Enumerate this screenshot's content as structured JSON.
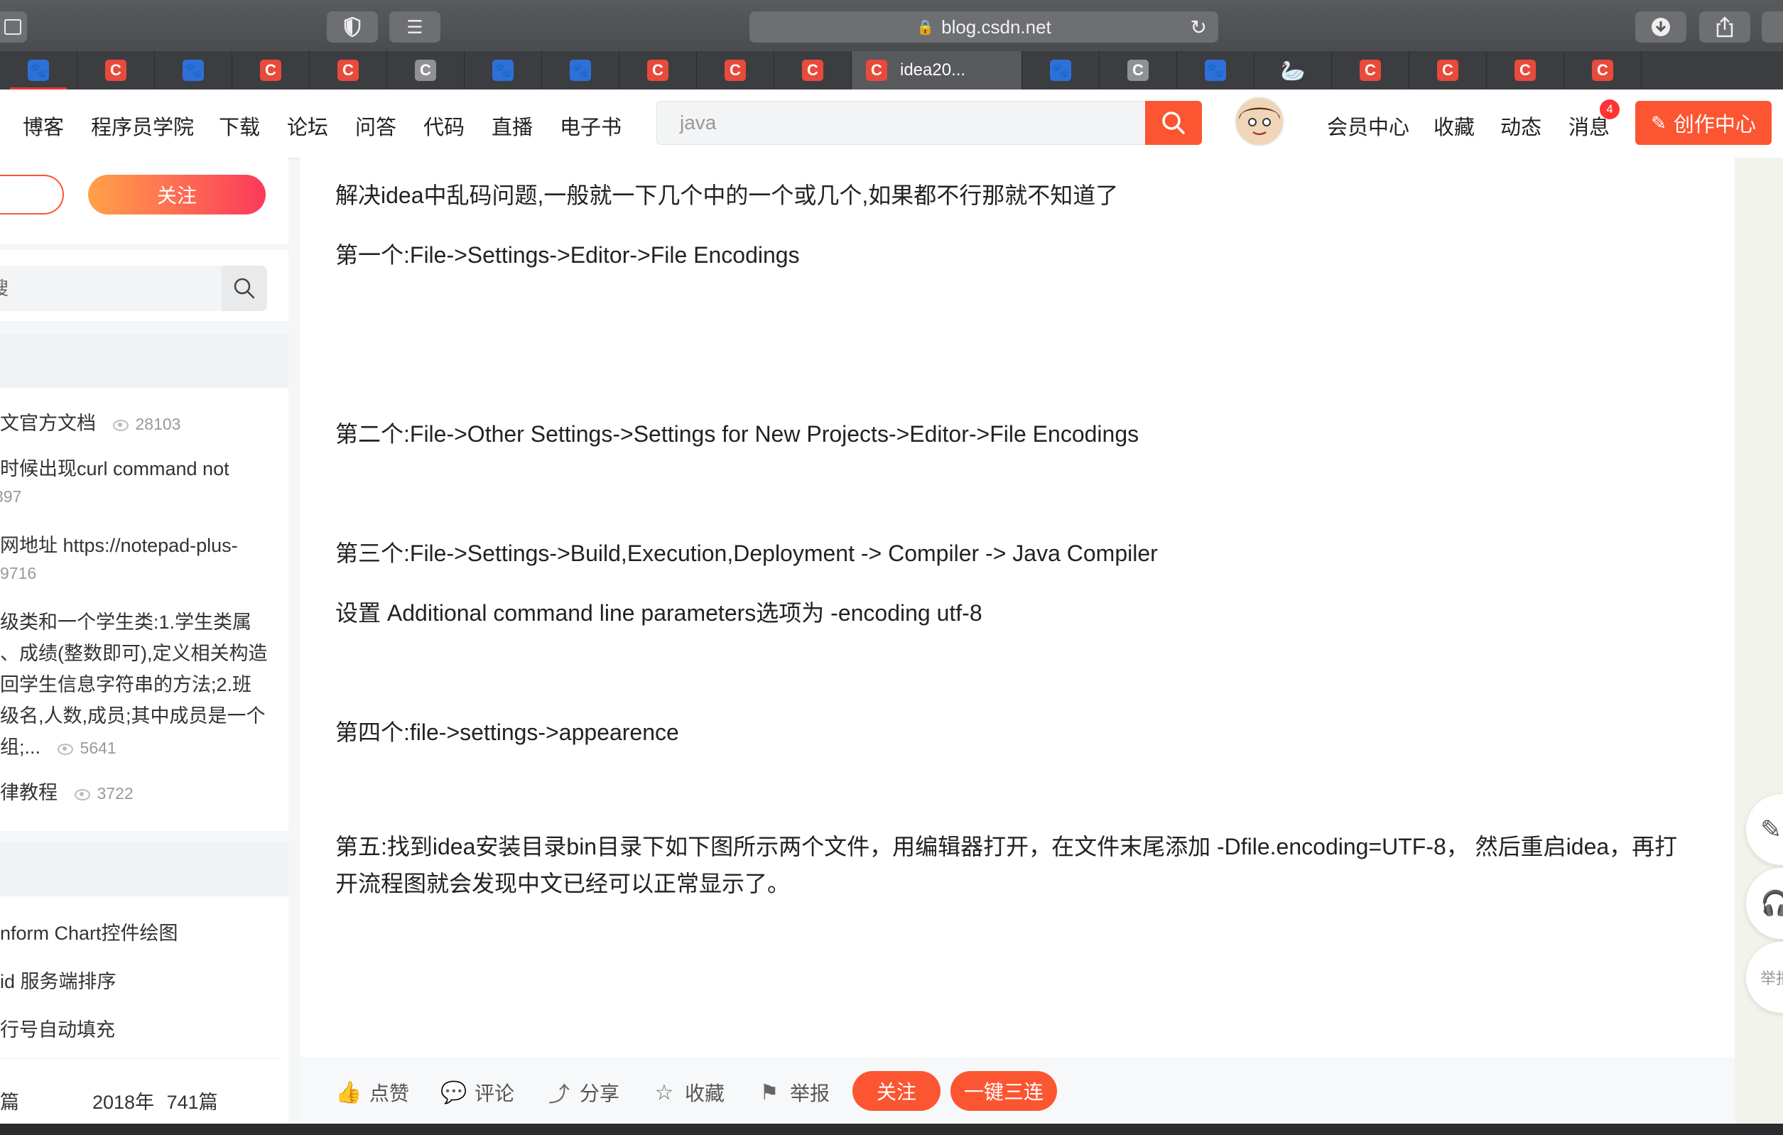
{
  "browser": {
    "url": "blog.csdn.net",
    "active_tab_title": "idea20...",
    "tabs": [
      "paw",
      "c",
      "paw",
      "c",
      "c",
      "cg",
      "paw",
      "paw",
      "c",
      "c",
      "c",
      "active",
      "paw",
      "cg",
      "paw",
      "swan",
      "c",
      "c",
      "c",
      "c",
      "c",
      "c"
    ]
  },
  "nav": {
    "items": [
      "博客",
      "程序员学院",
      "下载",
      "论坛",
      "问答",
      "代码",
      "直播",
      "电子书"
    ],
    "search_value": "java",
    "right_items": [
      "会员中心",
      "收藏",
      "动态",
      "消息"
    ],
    "message_badge": "4",
    "create_label": "创作中心"
  },
  "sidebar": {
    "follow_label": "关注",
    "search_text": "搜",
    "hot_articles": [
      {
        "title": "文官方文档",
        "views": "28103"
      },
      {
        "title": "时候出现curl command not",
        "views": "397"
      },
      {
        "title": "网地址 https://notepad-plus-",
        "views": "9716"
      },
      {
        "title_lines": [
          "级类和一个学生类:1.学生类属",
          "、成绩(整数即可),定义相关构造",
          "回学生信息字符串的方法;2.班",
          "级名,人数,成员;其中成员是一个",
          "组;..."
        ],
        "views": "5641"
      },
      {
        "title": "律教程",
        "views": "3722"
      }
    ],
    "categories": [
      "nform Chart控件绘图",
      "id 服务端排序",
      "行号自动填充"
    ],
    "archive": {
      "left": "篇",
      "year": "2018年",
      "count": "741篇"
    }
  },
  "article": {
    "paragraphs": [
      "解决idea中乱码问题,一般就一下几个中的一个或几个,如果都不行那就不知道了",
      "第一个:File->Settings->Editor->File Encodings",
      " 第二个:File->Other Settings->Settings for New Projects->Editor->File Encodings",
      "第三个:File->Settings->Build,Execution,Deployment -> Compiler -> Java Compiler",
      "设置 Additional command line parameters选项为 -encoding utf-8",
      "第四个:file->settings->appearence",
      " 第五:找到idea安装目录bin目录下如下图所示两个文件，用编辑器打开，在文件末尾添加 -Dfile.encoding=UTF-8， 然后重启idea，再打开流程图就会发现中文已经可以正常显示了。"
    ]
  },
  "actions": {
    "like": "点赞",
    "comment": "评论",
    "share": "分享",
    "collect": "收藏",
    "report": "举报",
    "follow": "关注",
    "triple": "一键三连"
  },
  "float_report": "举报"
}
